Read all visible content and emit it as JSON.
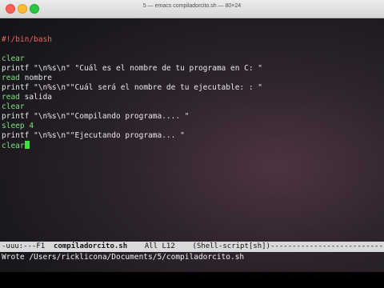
{
  "window": {
    "title": "5 — emacs compiladorcito.sh — 80×24"
  },
  "buffer": {
    "lines": [
      {
        "parts": [
          {
            "t": "#!/bin/bash",
            "c": "shebang"
          }
        ]
      },
      {
        "parts": []
      },
      {
        "parts": [
          {
            "t": "clear",
            "c": "bi"
          }
        ]
      },
      {
        "parts": [
          {
            "t": "printf ",
            "c": "kw"
          },
          {
            "t": "\"\\n%s\\n\" \"Cuál es el nombre de tu programa en C: \"",
            "c": "str"
          }
        ]
      },
      {
        "parts": [
          {
            "t": "read",
            "c": "bi"
          },
          {
            "t": " nombre",
            "c": "kw"
          }
        ]
      },
      {
        "parts": [
          {
            "t": "printf ",
            "c": "kw"
          },
          {
            "t": "\"\\n%s\\n\"\"Cuál será el nombre de tu ejecutable: : \"",
            "c": "str"
          }
        ]
      },
      {
        "parts": [
          {
            "t": "read",
            "c": "bi"
          },
          {
            "t": " salida",
            "c": "kw"
          }
        ]
      },
      {
        "parts": [
          {
            "t": "clear",
            "c": "bi"
          }
        ]
      },
      {
        "parts": [
          {
            "t": "printf ",
            "c": "kw"
          },
          {
            "t": "\"\\n%s\\n\"\"Compilando programa.... \"",
            "c": "str"
          }
        ]
      },
      {
        "parts": [
          {
            "t": "sleep 4",
            "c": "bi"
          }
        ]
      },
      {
        "parts": [
          {
            "t": "printf ",
            "c": "kw"
          },
          {
            "t": "\"\\n%s\\n\"\"Ejecutando programa... \"",
            "c": "str"
          }
        ]
      },
      {
        "parts": [
          {
            "t": "clear",
            "c": "bi"
          }
        ],
        "cursor": true
      }
    ]
  },
  "modeline": {
    "prefix": "-uuu:---F1  ",
    "buffer_name": "compiladorcito.sh",
    "position": "    All L12",
    "mode": "    (Shell-script[sh])",
    "fill": "------------------------------------------"
  },
  "echo_area": {
    "message": "Wrote /Users/ricklicona/Documents/5/compiladorcito.sh"
  }
}
